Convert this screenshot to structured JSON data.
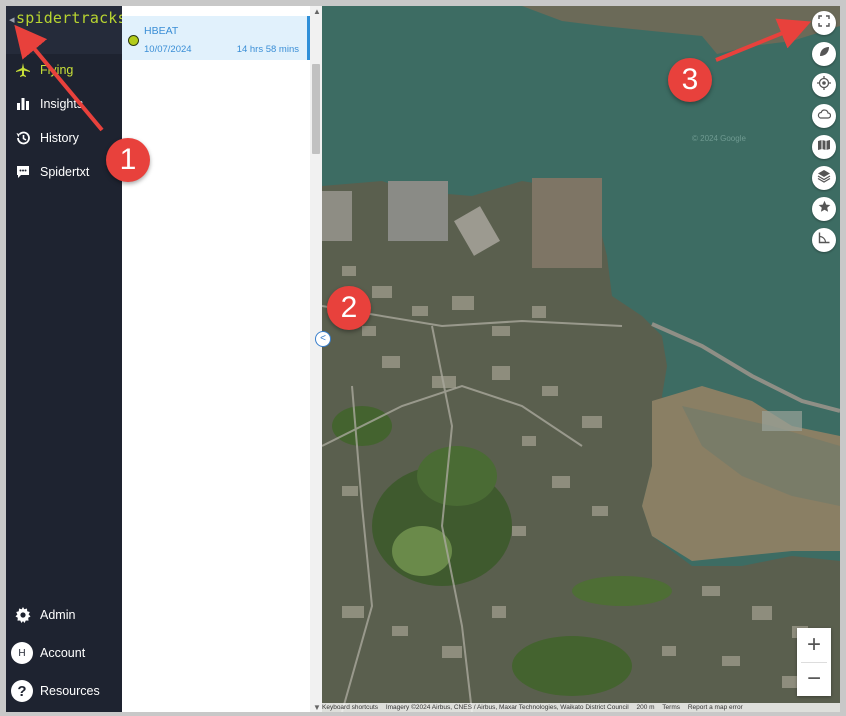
{
  "app": {
    "brand": "spidertracks",
    "collapse_caret": "◂"
  },
  "sidebar": {
    "items": [
      {
        "label": "Flying",
        "icon": "airplane-icon",
        "active": true
      },
      {
        "label": "Insights",
        "icon": "bar-chart-icon"
      },
      {
        "label": "History",
        "icon": "history-icon"
      },
      {
        "label": "Spidertxt",
        "icon": "chat-icon"
      }
    ],
    "bottom_items": [
      {
        "label": "Admin",
        "icon": "gear-icon"
      },
      {
        "label": "Account",
        "icon": "avatar-icon",
        "avatar_letter": "H"
      },
      {
        "label": "Resources",
        "icon": "help-icon",
        "glyph": "?"
      }
    ]
  },
  "flight_list": {
    "flights": [
      {
        "name": "HBEAT",
        "date": "10/07/2024",
        "duration": "14 hrs 58 mins",
        "status_color": "#b3cc1a"
      }
    ]
  },
  "map": {
    "controls": [
      "fullscreen-icon",
      "leaf-icon",
      "locate-icon",
      "cloud-icon",
      "map-icon",
      "layers-icon",
      "star-icon",
      "ruler-icon"
    ],
    "zoom_in": "+",
    "zoom_out": "−",
    "collapse_button": "<",
    "watermark": "© 2024 Google",
    "attribution": {
      "shortcuts": "Keyboard shortcuts",
      "imagery": "Imagery ©2024 Airbus, CNES / Airbus, Maxar Technologies, Waikato District Council",
      "scale": "200 m",
      "terms": "Terms",
      "report": "Report a map error"
    }
  },
  "annotations": [
    {
      "label": "1",
      "color": "#e8413c"
    },
    {
      "label": "2",
      "color": "#e8413c"
    },
    {
      "label": "3",
      "color": "#e8413c"
    }
  ]
}
